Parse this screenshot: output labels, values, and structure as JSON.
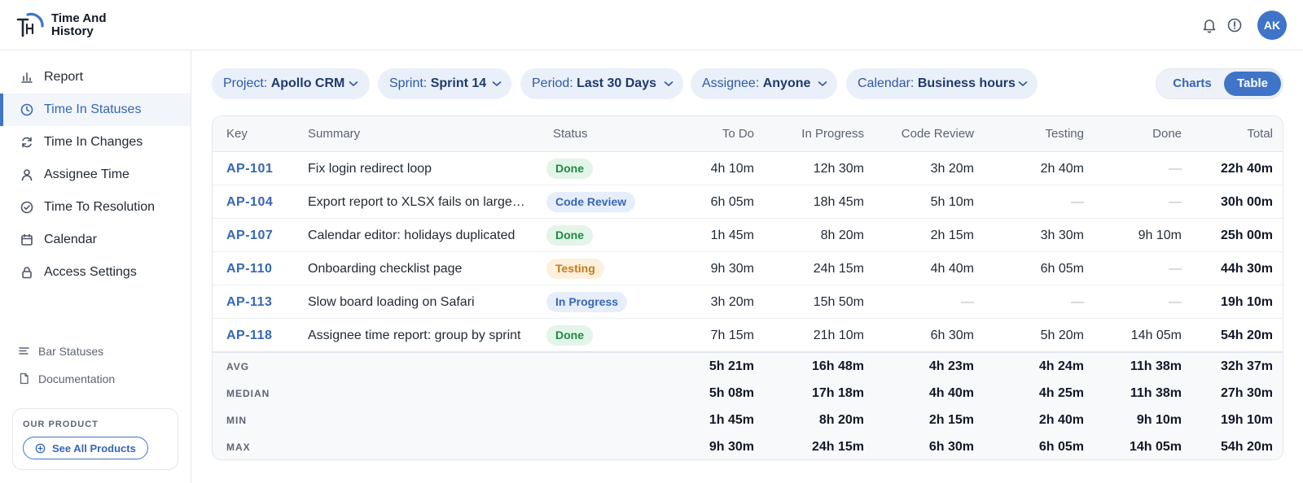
{
  "brand": {
    "line1": "Time And",
    "line2": "History",
    "avatar": "AK"
  },
  "sidebar": {
    "items": [
      {
        "label": "Report",
        "icon": "bar-chart-icon",
        "active": false
      },
      {
        "label": "Time In Statuses",
        "icon": "clock-icon",
        "active": true
      },
      {
        "label": "Time In Changes",
        "icon": "refresh-icon",
        "active": false
      },
      {
        "label": "Assignee Time",
        "icon": "user-icon",
        "active": false
      },
      {
        "label": "Time To Resolution",
        "icon": "check-circle-icon",
        "active": false
      },
      {
        "label": "Calendar",
        "icon": "calendar-icon",
        "active": false
      },
      {
        "label": "Access Settings",
        "icon": "lock-icon",
        "active": false
      }
    ],
    "bottom": [
      {
        "label": "Bar Statuses",
        "icon": "bars-icon"
      },
      {
        "label": "Documentation",
        "icon": "document-icon"
      }
    ],
    "product": {
      "title": "OUR PRODUCT",
      "button": "See All Products"
    }
  },
  "filters": [
    {
      "label": "Project:",
      "value": "Apollo CRM"
    },
    {
      "label": "Sprint:",
      "value": "Sprint 14"
    },
    {
      "label": "Period:",
      "value": "Last 30 Days"
    },
    {
      "label": "Assignee:",
      "value": "Anyone"
    },
    {
      "label": "Calendar:",
      "value": "Business hours"
    }
  ],
  "view_toggle": {
    "charts": "Charts",
    "table": "Table",
    "selected": "Table"
  },
  "table": {
    "columns": [
      "Key",
      "Summary",
      "Status",
      "To Do",
      "In Progress",
      "Code Review",
      "Testing",
      "Done",
      "Total"
    ],
    "rows": [
      {
        "key": "AP-101",
        "summary": "Fix login redirect loop",
        "status": "Done",
        "todo": "4h 10m",
        "inprogress": "12h 30m",
        "codereview": "3h 20m",
        "testing": "2h 40m",
        "done": "—",
        "total": "22h 40m"
      },
      {
        "key": "AP-104",
        "summary": "Export report to XLSX fails on large datasets",
        "status": "Code Review",
        "todo": "6h 05m",
        "inprogress": "18h 45m",
        "codereview": "5h 10m",
        "testing": "—",
        "done": "—",
        "total": "30h 00m"
      },
      {
        "key": "AP-107",
        "summary": "Calendar editor: holidays duplicated",
        "status": "Done",
        "todo": "1h 45m",
        "inprogress": "8h 20m",
        "codereview": "2h 15m",
        "testing": "3h 30m",
        "done": "9h 10m",
        "total": "25h 00m"
      },
      {
        "key": "AP-110",
        "summary": "Onboarding checklist page",
        "status": "Testing",
        "todo": "9h 30m",
        "inprogress": "24h 15m",
        "codereview": "4h 40m",
        "testing": "6h 05m",
        "done": "—",
        "total": "44h 30m"
      },
      {
        "key": "AP-113",
        "summary": "Slow board loading on Safari",
        "status": "In Progress",
        "todo": "3h 20m",
        "inprogress": "15h 50m",
        "codereview": "—",
        "testing": "—",
        "done": "—",
        "total": "19h 10m"
      },
      {
        "key": "AP-118",
        "summary": "Assignee time report: group by sprint",
        "status": "Done",
        "todo": "7h 15m",
        "inprogress": "21h 10m",
        "codereview": "6h 30m",
        "testing": "5h 20m",
        "done": "14h 05m",
        "total": "54h 20m"
      }
    ],
    "stats": [
      {
        "label": "AVG",
        "todo": "5h 21m",
        "inprogress": "16h 48m",
        "codereview": "4h 23m",
        "testing": "4h 24m",
        "done": "11h 38m",
        "total": "32h 37m"
      },
      {
        "label": "MEDIAN",
        "todo": "5h 08m",
        "inprogress": "17h 18m",
        "codereview": "4h 40m",
        "testing": "4h 25m",
        "done": "11h 38m",
        "total": "27h 30m"
      },
      {
        "label": "MIN",
        "todo": "1h 45m",
        "inprogress": "8h 20m",
        "codereview": "2h 15m",
        "testing": "2h 40m",
        "done": "9h 10m",
        "total": "19h 10m"
      },
      {
        "label": "MAX",
        "todo": "9h 30m",
        "inprogress": "24h 15m",
        "codereview": "6h 30m",
        "testing": "6h 05m",
        "done": "14h 05m",
        "total": "54h 20m"
      }
    ]
  },
  "status_colors": {
    "Done": {
      "bg": "#e3f5e8",
      "fg": "#1f8a43"
    },
    "Code Review": {
      "bg": "#e7eefb",
      "fg": "#3566b8"
    },
    "Testing": {
      "bg": "#fdf0dc",
      "fg": "#c67a12"
    },
    "In Progress": {
      "bg": "#e7eefb",
      "fg": "#3566b8"
    }
  },
  "colors": {
    "accent": "#3f74c9"
  }
}
